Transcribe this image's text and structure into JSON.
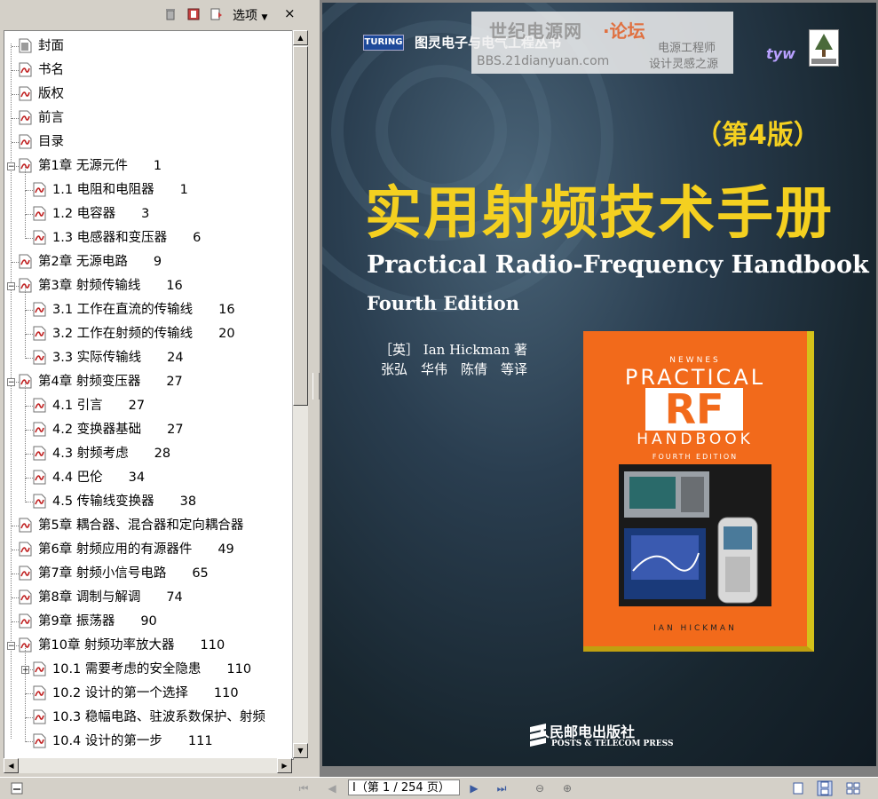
{
  "toolbar": {
    "options_label": "选项",
    "close_label": "×"
  },
  "bookmarks": [
    {
      "label": "封面",
      "level": 0,
      "page": "",
      "expand": "",
      "icon": "page"
    },
    {
      "label": "书名",
      "level": 0,
      "page": "",
      "expand": "",
      "icon": "pdf"
    },
    {
      "label": "版权",
      "level": 0,
      "page": "",
      "expand": "",
      "icon": "pdf"
    },
    {
      "label": "前言",
      "level": 0,
      "page": "",
      "expand": "",
      "icon": "pdf"
    },
    {
      "label": "目录",
      "level": 0,
      "page": "",
      "expand": "",
      "icon": "pdf"
    },
    {
      "label": "第1章 无源元件",
      "level": 0,
      "page": "1",
      "expand": "−",
      "icon": "pdf"
    },
    {
      "label": "1.1 电阻和电阻器",
      "level": 1,
      "page": "1",
      "expand": "",
      "icon": "pdf"
    },
    {
      "label": "1.2 电容器",
      "level": 1,
      "page": "3",
      "expand": "",
      "icon": "pdf"
    },
    {
      "label": "1.3 电感器和变压器",
      "level": 1,
      "page": "6",
      "expand": "",
      "icon": "pdf"
    },
    {
      "label": "第2章 无源电路",
      "level": 0,
      "page": "9",
      "expand": "",
      "icon": "pdf"
    },
    {
      "label": "第3章 射频传输线",
      "level": 0,
      "page": "16",
      "expand": "−",
      "icon": "pdf"
    },
    {
      "label": "3.1 工作在直流的传输线",
      "level": 1,
      "page": "16",
      "expand": "",
      "icon": "pdf"
    },
    {
      "label": "3.2 工作在射频的传输线",
      "level": 1,
      "page": "20",
      "expand": "",
      "icon": "pdf"
    },
    {
      "label": "3.3 实际传输线",
      "level": 1,
      "page": "24",
      "expand": "",
      "icon": "pdf"
    },
    {
      "label": "第4章 射频变压器",
      "level": 0,
      "page": "27",
      "expand": "−",
      "icon": "pdf"
    },
    {
      "label": "4.1 引言",
      "level": 1,
      "page": "27",
      "expand": "",
      "icon": "pdf"
    },
    {
      "label": "4.2 变换器基础",
      "level": 1,
      "page": "27",
      "expand": "",
      "icon": "pdf"
    },
    {
      "label": "4.3 射频考虑",
      "level": 1,
      "page": "28",
      "expand": "",
      "icon": "pdf"
    },
    {
      "label": "4.4 巴伦",
      "level": 1,
      "page": "34",
      "expand": "",
      "icon": "pdf"
    },
    {
      "label": "4.5 传输线变换器",
      "level": 1,
      "page": "38",
      "expand": "",
      "icon": "pdf"
    },
    {
      "label": "第5章 耦合器、混合器和定向耦合器",
      "level": 0,
      "page": "",
      "expand": "",
      "icon": "pdf"
    },
    {
      "label": "第6章 射频应用的有源器件",
      "level": 0,
      "page": "49",
      "expand": "",
      "icon": "pdf"
    },
    {
      "label": "第7章 射频小信号电路",
      "level": 0,
      "page": "65",
      "expand": "",
      "icon": "pdf"
    },
    {
      "label": "第8章 调制与解调",
      "level": 0,
      "page": "74",
      "expand": "",
      "icon": "pdf"
    },
    {
      "label": "第9章 振荡器",
      "level": 0,
      "page": "90",
      "expand": "",
      "icon": "pdf"
    },
    {
      "label": "第10章 射频功率放大器",
      "level": 0,
      "page": "110",
      "expand": "−",
      "icon": "pdf"
    },
    {
      "label": "10.1 需要考虑的安全隐患",
      "level": 1,
      "page": "110",
      "expand": "+",
      "icon": "pdf"
    },
    {
      "label": "10.2 设计的第一个选择",
      "level": 1,
      "page": "110",
      "expand": "",
      "icon": "pdf"
    },
    {
      "label": "10.3 稳幅电路、驻波系数保护、射频",
      "level": 1,
      "page": "",
      "expand": "",
      "icon": "pdf"
    },
    {
      "label": "10.4 设计的第一步",
      "level": 1,
      "page": "111",
      "expand": "",
      "icon": "pdf"
    }
  ],
  "cover": {
    "turing_logo": "TURING",
    "series_name": "图灵电子与电气工程丛书",
    "watermark_title": "世纪电源网",
    "watermark_forum": "·论坛",
    "watermark_url": "BBS.21dianyuan.com",
    "watermark_slogan1": "电源工程师",
    "watermark_slogan2": "设计灵感之源",
    "tyw_mark": "tyw",
    "edition": "（第4版）",
    "title_cn": "实用射频技术手册",
    "title_en": "Practical Radio-Frequency Handbook",
    "edition_en": "Fourth Edition",
    "author_line": "［英］ Ian Hickman 著",
    "translators": "张弘　华伟　陈倩　等译",
    "inner_book": {
      "newnes": "NEWNES",
      "practical": "PRACTICAL",
      "rf": "RF",
      "handbook": "HANDBOOK",
      "fourth": "FOURTH EDITION",
      "author": "IAN HICKMAN"
    },
    "publisher": "人民邮电出版社",
    "publisher_en": "POSTS & TELECOM PRESS"
  },
  "status": {
    "page_display": "I（第 1 / 254 页）"
  }
}
